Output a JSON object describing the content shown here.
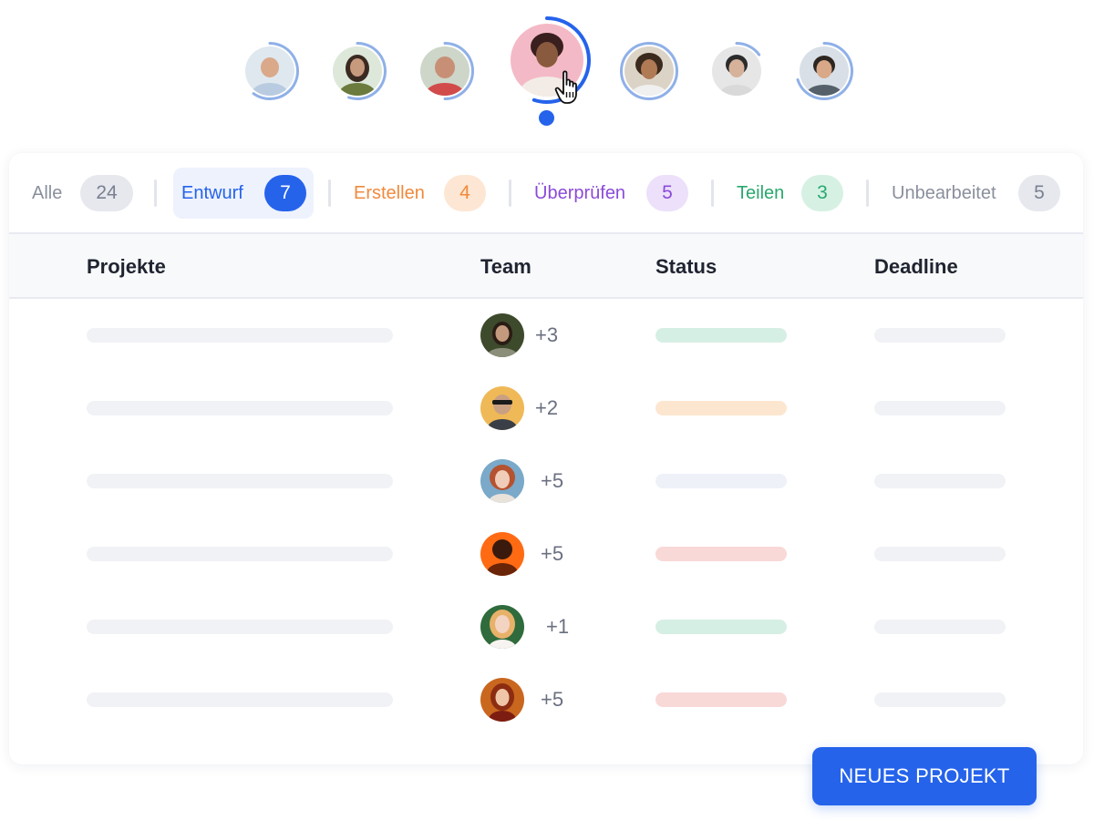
{
  "colors": {
    "accent": "#2563eb",
    "ring": "#8fb0e8",
    "status_green": "#d6efe4",
    "status_orange": "#fde6cf",
    "status_blue": "#eef1f8",
    "status_red": "#f9d8d8"
  },
  "avatar_strip": {
    "avatars": [
      {
        "name": "avatar-1",
        "progress": 0.6,
        "active": false
      },
      {
        "name": "avatar-2",
        "progress": 0.55,
        "active": false
      },
      {
        "name": "avatar-3",
        "progress": 0.5,
        "active": false
      },
      {
        "name": "avatar-4",
        "progress": 0.55,
        "active": true
      },
      {
        "name": "avatar-5",
        "progress": 1.0,
        "active": false
      },
      {
        "name": "avatar-6",
        "progress": 0.15,
        "active": false
      },
      {
        "name": "avatar-7",
        "progress": 0.7,
        "active": false
      }
    ]
  },
  "tabs": [
    {
      "label": "Alle",
      "count": "24",
      "color": "#8a8f9c",
      "badge_bg": "#e6e8ee",
      "badge_fg": "#7b8090"
    },
    {
      "label": "Entwurf",
      "count": "7",
      "color": "#2563eb",
      "badge_bg": "#2563eb",
      "badge_fg": "#ffffff",
      "active": true
    },
    {
      "label": "Erstellen",
      "count": "4",
      "color": "#f08a3c",
      "badge_bg": "#fde6d3",
      "badge_fg": "#f08a3c"
    },
    {
      "label": "Überprüfen",
      "count": "5",
      "color": "#8b4ad8",
      "badge_bg": "#ece0fa",
      "badge_fg": "#8b4ad8"
    },
    {
      "label": "Teilen",
      "count": "3",
      "color": "#2aa86f",
      "badge_bg": "#d6f1e4",
      "badge_fg": "#2aa86f"
    },
    {
      "label": "Unbearbeitet",
      "count": "5",
      "color": "#8a8f9c",
      "badge_bg": "#e6e8ee",
      "badge_fg": "#7b8090"
    }
  ],
  "table": {
    "headers": {
      "project": "Projekte",
      "team": "Team",
      "status": "Status",
      "deadline": "Deadline"
    },
    "rows": [
      {
        "team_extra": "+3",
        "status": "green"
      },
      {
        "team_extra": "+2",
        "status": "orange"
      },
      {
        "team_extra": "+5",
        "status": "blue"
      },
      {
        "team_extra": "+5",
        "status": "red"
      },
      {
        "team_extra": "+1",
        "status": "green"
      },
      {
        "team_extra": "+5",
        "status": "red"
      }
    ]
  },
  "actions": {
    "new_project_label": "NEUES PROJEKT"
  }
}
